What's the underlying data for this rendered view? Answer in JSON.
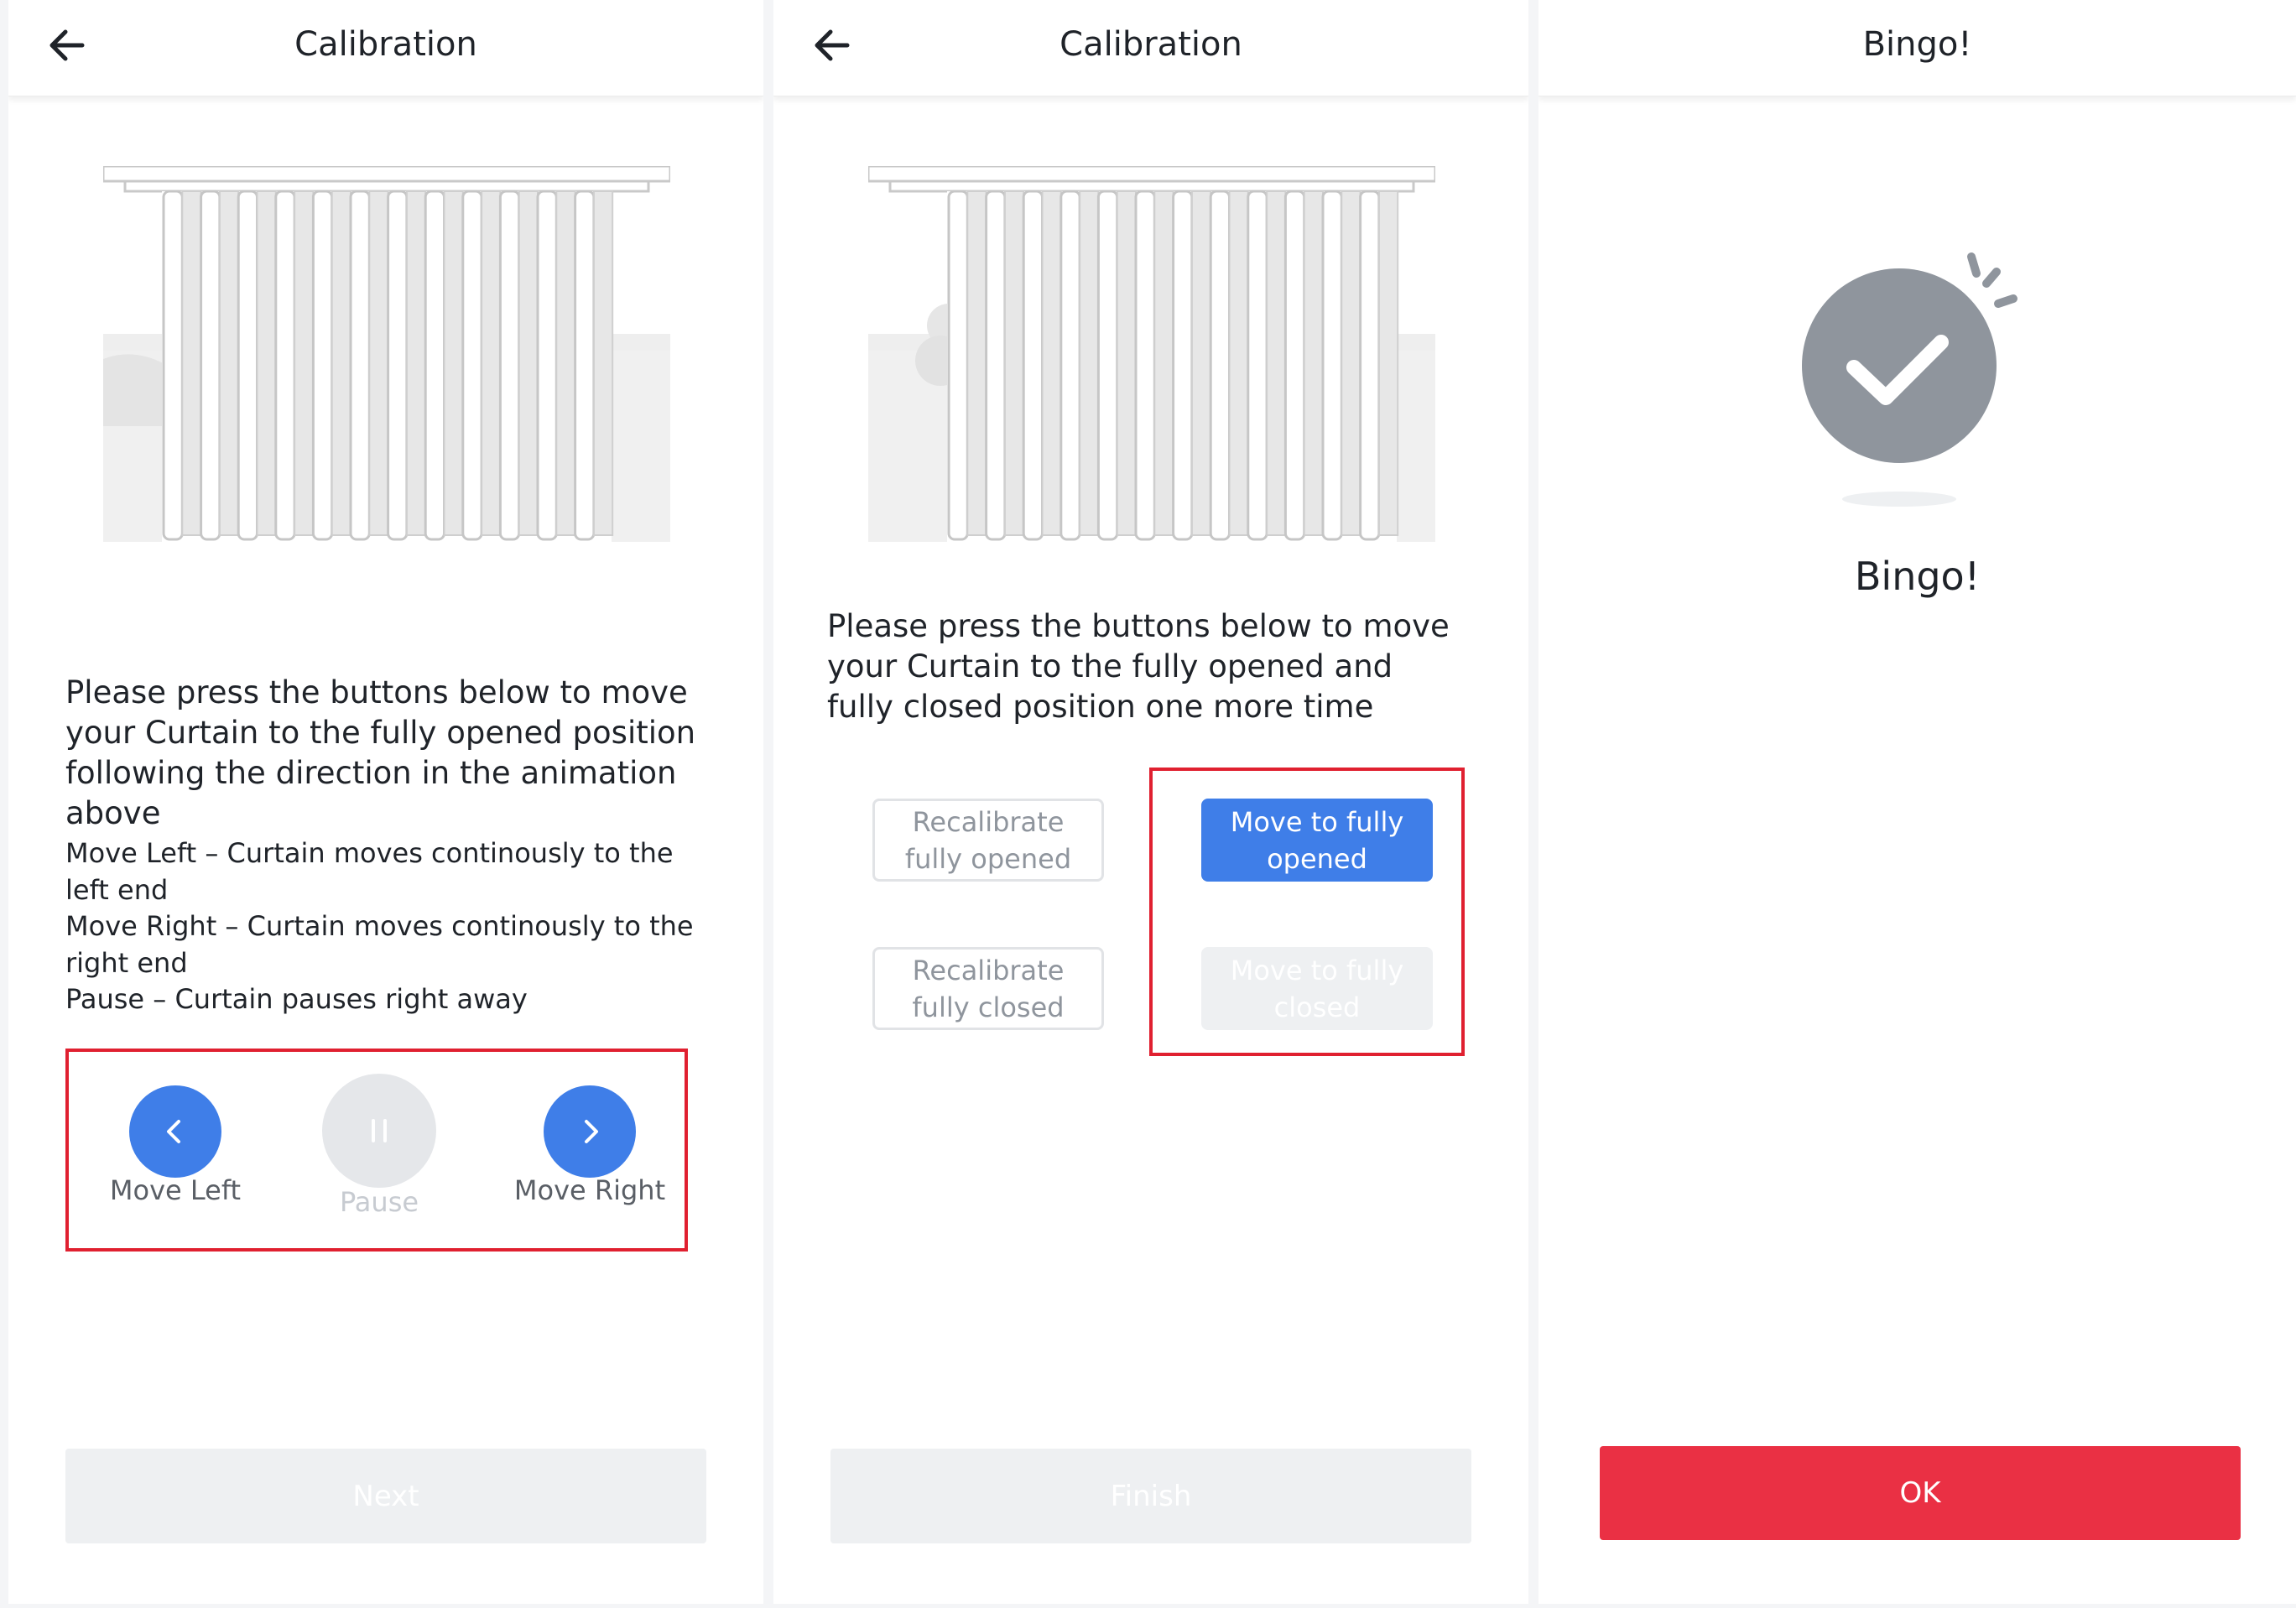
{
  "screens": [
    {
      "title": "Calibration",
      "instructions": "Please press the buttons below to move your Curtain to the fully opened position following the direction in the animation above",
      "notes": [
        "Move Left – Curtain moves continously to the left end",
        "Move Right – Curtain moves continously to the right end",
        "Pause – Curtain pauses right away"
      ],
      "controls": {
        "move_left": "Move Left",
        "pause": "Pause",
        "move_right": "Move Right"
      },
      "bottom_button": "Next"
    },
    {
      "title": "Calibration",
      "instructions": "Please press the buttons below to move your Curtain to the fully opened and fully closed position one more time",
      "buttons": {
        "recalibrate_opened": "Recalibrate fully opened",
        "move_opened": "Move to fully opened",
        "recalibrate_closed": "Recalibrate fully closed",
        "move_closed": "Move to fully closed"
      },
      "bottom_button": "Finish"
    },
    {
      "title": "Bingo!",
      "message": "Bingo!",
      "bottom_button": "OK"
    }
  ],
  "colors": {
    "accent_blue": "#3f7ee8",
    "ok_red": "#ea3044",
    "highlight_red": "#e02030",
    "disabled_gray": "#eef0f2",
    "check_gray": "#8f959d"
  }
}
